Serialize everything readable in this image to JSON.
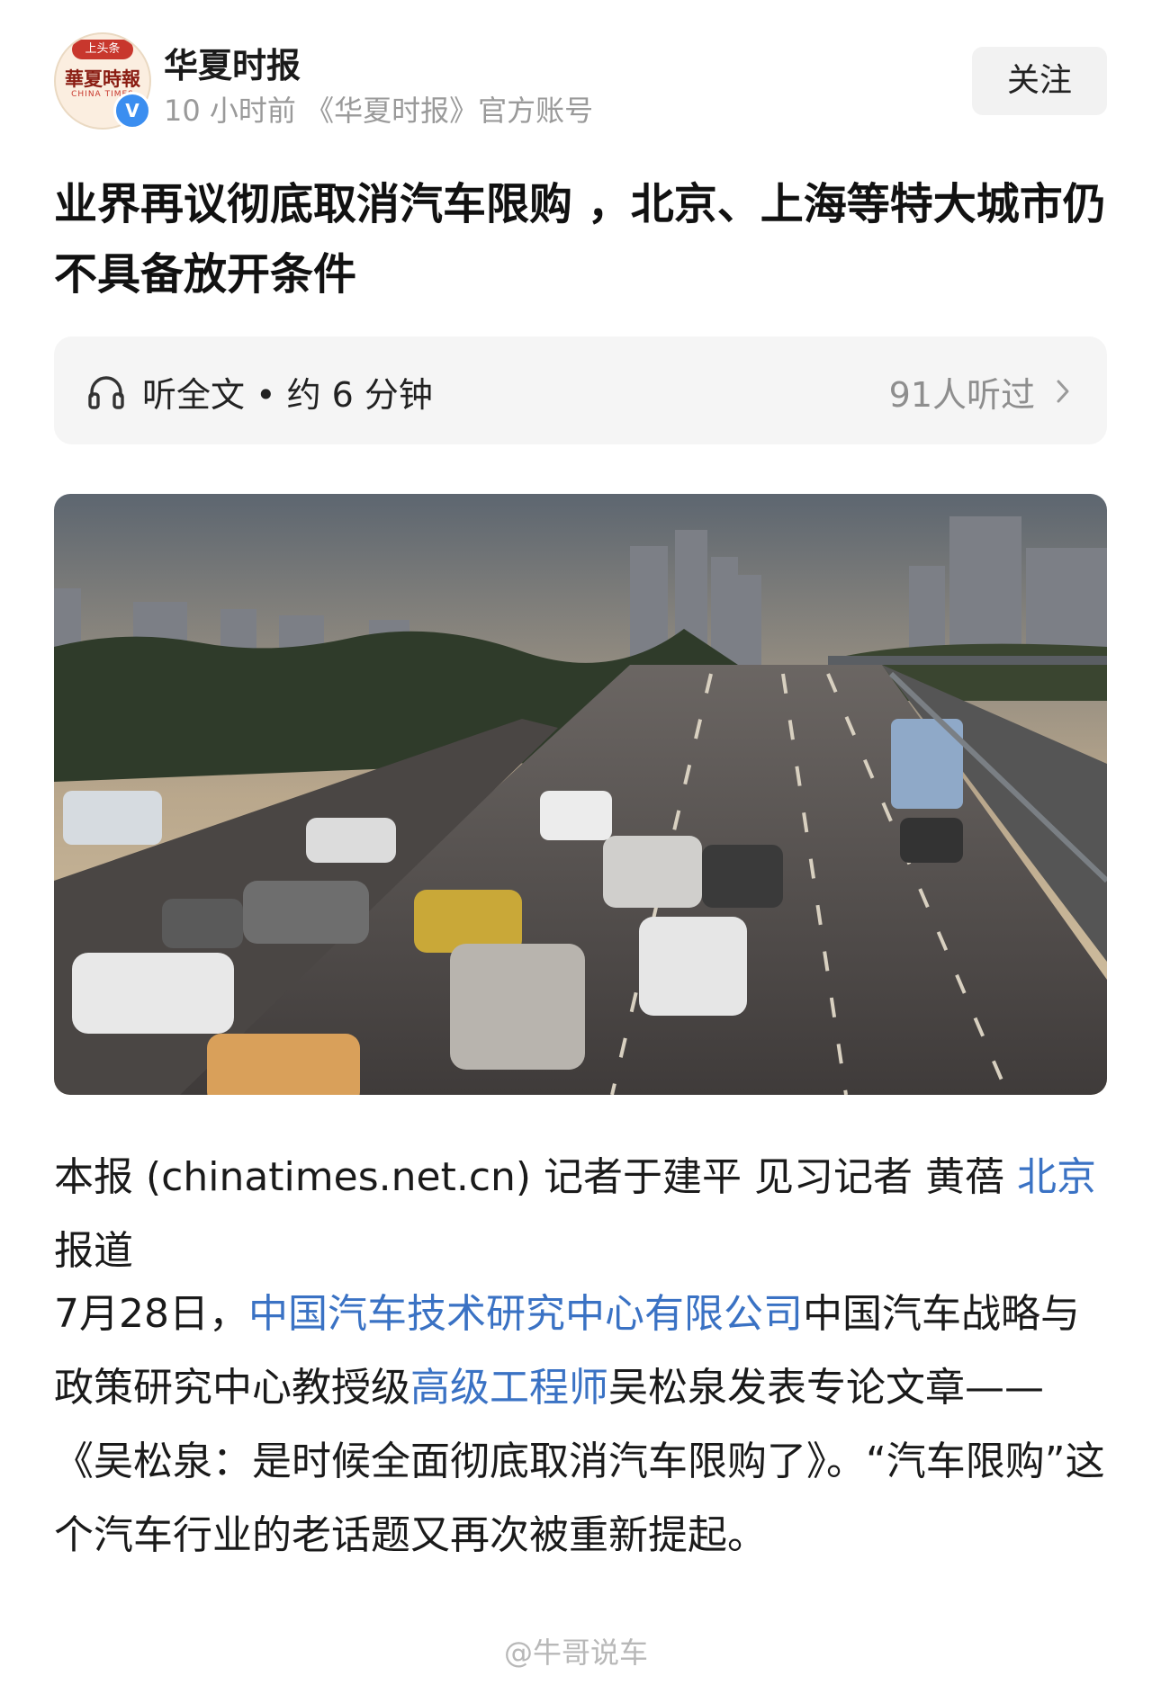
{
  "account": {
    "name": "华夏时报",
    "meta": "10 小时前 《华夏时报》官方账号",
    "follow_label": "关注",
    "avatar_logo": "華夏時報",
    "avatar_sub": "CHINA TIMES",
    "avatar_ribbon": "上头条",
    "verified_badge": "V",
    "verified_color": "#3b8ef0"
  },
  "article": {
    "title": "业界再议彻底取消汽车限购 ，北京、上海等特大城市仍不具备放开条件",
    "listen": {
      "label": "听全文 • 约 6 分钟",
      "count": "91人听过"
    },
    "image_icon": "photo-highway-traffic",
    "byline": {
      "part1": "本报 (chinatimes.net.cn) 记者于建平 见习记者 黄蓓 ",
      "link": "北京",
      "part2": "报道"
    },
    "paragraph": {
      "t1": "7月28日，",
      "link1": "中国汽车技术研究中心有限公司",
      "t2": "中国汽车战略与政策研究中心教授级",
      "link2": "高级工程师",
      "t3": "吴松泉发表专论文章——《吴松泉：是时候全面彻底取消汽车限购了》。“汽车限购”这个汽车行业的老话题又再次被重新提起。"
    }
  },
  "watermark": "@牛哥说车",
  "colors": {
    "link": "#3a72c4",
    "muted": "#9a9a9a",
    "bar_bg": "#f5f5f5"
  },
  "icons": {
    "listen": "headphone-icon",
    "more": "chevron-right-icon",
    "watermark": "weibo-icon"
  }
}
